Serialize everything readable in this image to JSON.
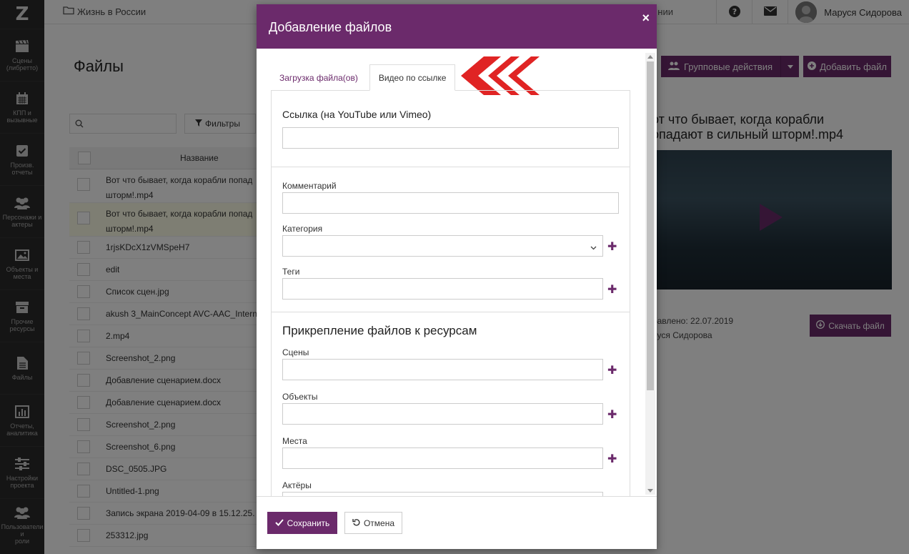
{
  "sidebar": {
    "logo": "Z",
    "items": [
      {
        "label": "Сцены\n(либретто)",
        "icon": "clapperboard-icon"
      },
      {
        "label": "КПП и\nвызывные",
        "icon": "calendar-icon"
      },
      {
        "label": "Произв.\nотчеты",
        "icon": "checkbox-icon"
      },
      {
        "label": "Персонажи и\nактеры",
        "icon": "users-icon"
      },
      {
        "label": "Объекты и\nместа",
        "icon": "image-icon"
      },
      {
        "label": "Прочие\nресурсы",
        "icon": "archive-icon"
      },
      {
        "label": "Файлы",
        "icon": "file-icon"
      },
      {
        "label": "Отчеты,\nаналитика",
        "icon": "bar-chart-icon"
      },
      {
        "label": "Настройки\nпроекта",
        "icon": "sliders-icon"
      },
      {
        "label": "Пользователи и\nроли",
        "icon": "users-icon"
      }
    ]
  },
  "topbar": {
    "breadcrumb": "Жизнь в России",
    "partial_label": "нии",
    "user_name": "Маруся Сидорова"
  },
  "page": {
    "title": "Файлы",
    "filter_label": "Фильтры",
    "group_actions_label": "Групповые действия",
    "add_file_label": "Добавить файл"
  },
  "table": {
    "header_name": "Название",
    "rows": [
      "Вот что бывает, когда корабли попад\nшторм!.mp4",
      "Вот что бывает, когда корабли попад\nшторм!.mp4",
      "1rjsKDcX1zVMSpeH7",
      "edit",
      "Список сцен.jpg",
      "akush 3_MainConcept AVC-AAC_Interne",
      "2.mp4",
      "Screenshot_2.png",
      "Добавление сценарием.docx",
      "Добавление сценарием.docx",
      "Screenshot_2.png",
      "Screenshot_6.png",
      "DSC_0505.JPG",
      "Untitled-1.png",
      "Запись экрана 2019-04-09 в 15.12.25.",
      "253312.jpg"
    ]
  },
  "preview": {
    "title": "от что бывает, когда корабли\nопадают в сильный шторм!.mp4",
    "added": "бавлено: 22.07.2019",
    "author": "руся Сидорова",
    "download_label": "Скачать файл"
  },
  "modal": {
    "title": "Добавление файлов",
    "close": "×",
    "tabs": [
      "Загрузка файла(ов)",
      "Видео по ссылке"
    ],
    "active_tab": 1,
    "link_label": "Ссылка (на YouTube или Vimeo)",
    "link_value": "",
    "comment_label": "Комментарий",
    "category_label": "Категория",
    "tags_label": "Теги",
    "attach_heading": "Прикрепление файлов к ресурсам",
    "scenes_label": "Сцены",
    "objects_label": "Объекты",
    "places_label": "Места",
    "actors_label": "Актёры",
    "save_label": "Сохранить",
    "cancel_label": "Отмена"
  },
  "colors": {
    "brand": "#6b2a6b",
    "sidebar": "#2b2b2b",
    "arrow": "#e02424"
  }
}
